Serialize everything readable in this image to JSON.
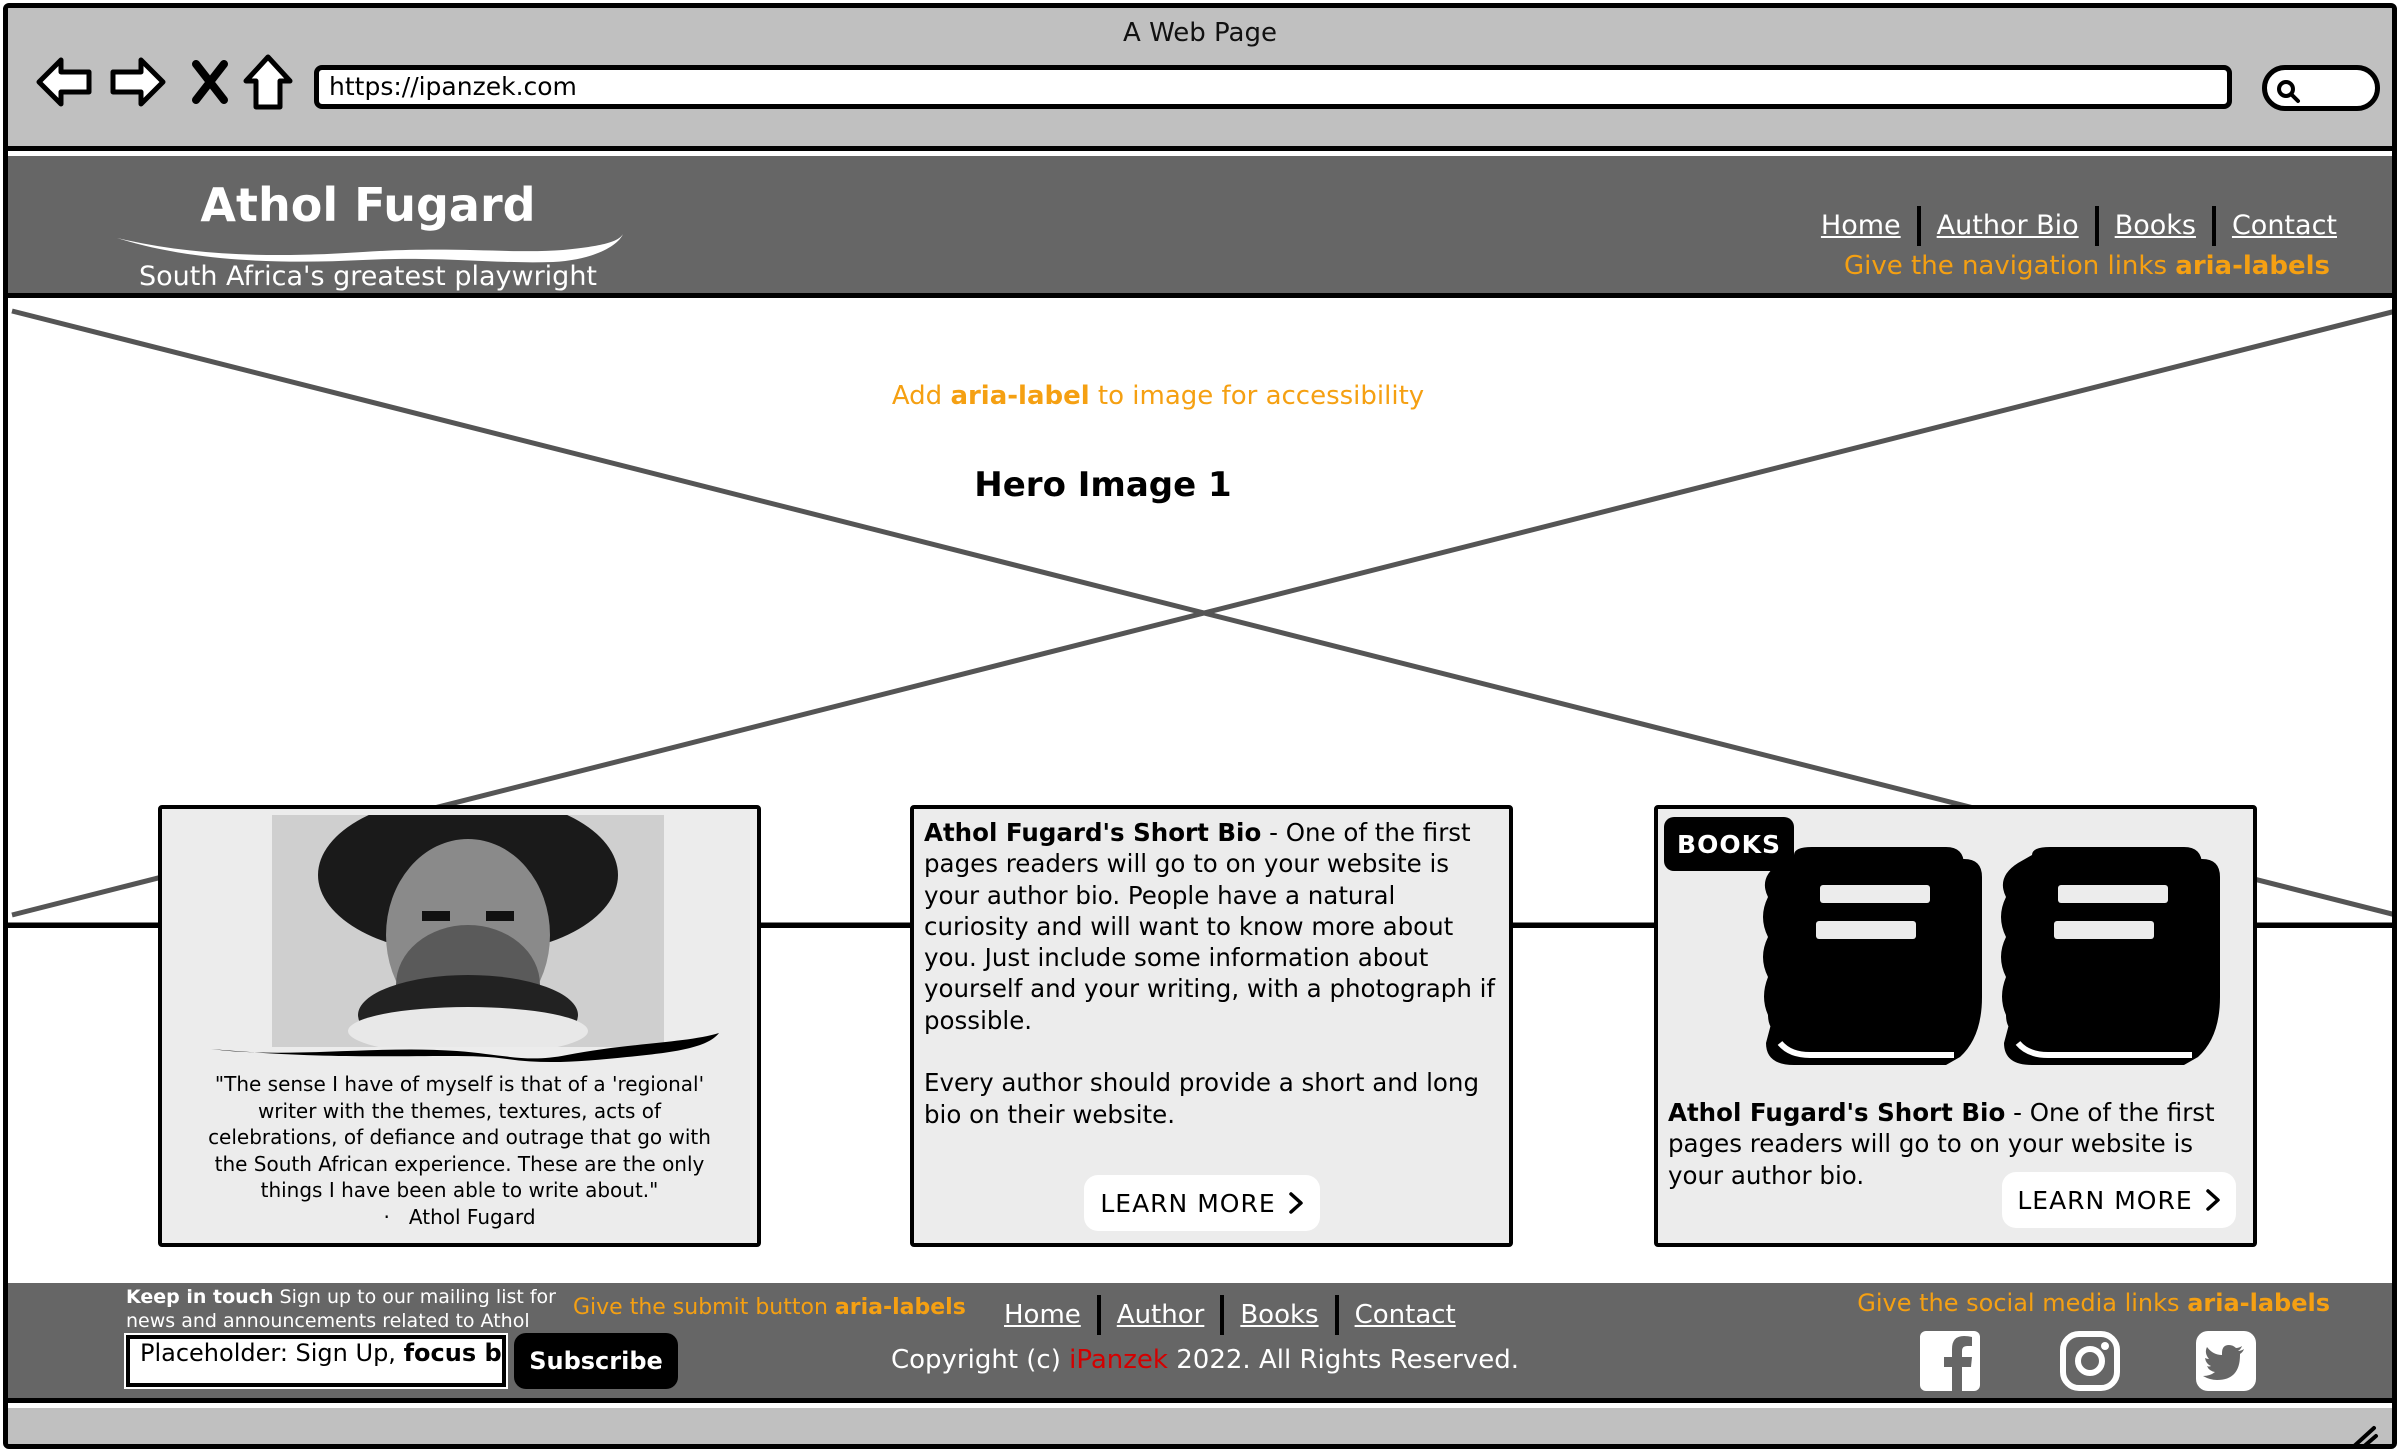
{
  "window": {
    "title": "A Web Page"
  },
  "browser": {
    "url": "https://ipanzek.com",
    "icons": [
      "back-arrow-icon",
      "forward-arrow-icon",
      "close-x-icon",
      "home-icon",
      "search-icon"
    ]
  },
  "header": {
    "site_title": "Athol Fugard",
    "tagline": "South Africa's greatest playwright",
    "nav": [
      "Home",
      "Author Bio",
      "Books",
      "Contact"
    ],
    "nav_note_prefix": "Give the navigation links ",
    "nav_note_strong": "aria-labels"
  },
  "hero": {
    "note_prefix": "Add ",
    "note_strong": "aria-label",
    "note_suffix": " to image for accessibility",
    "title": "Hero Image 1"
  },
  "cards": {
    "quote": {
      "text": "\"The sense I have of myself is that of a 'regional' writer with the themes, textures, acts of celebrations, of defiance and outrage that go with the South African experience. These are the only things I have been able to write about.\"",
      "attribution": "Athol Fugard"
    },
    "bio": {
      "title": "Athol Fugard's Short Bio",
      "paragraph1": " - One of the first pages readers will go to on your website is your author bio. People have a natural curiosity and will want to know more about you. Just include some information about yourself and your writing, with a photograph if possible.",
      "paragraph2": "Every author should provide a short and long bio on their website.",
      "button": "LEARN MORE"
    },
    "books": {
      "badge": "BOOKS",
      "title": "Athol Fugard's Short Bio",
      "text": " - One of the first pages readers will go to on your website is your author bio.",
      "button": "LEARN MORE"
    }
  },
  "footer": {
    "keep_strong": "Keep in touch",
    "keep_text": " Sign up to our mailing list for news and announcements related to Athol Fugard",
    "submit_note_prefix": "Give the submit button ",
    "submit_note_strong": "aria-labels",
    "signup_placeholder_plain": "Placeholder: Sign Up, ",
    "signup_placeholder_strong": "focus b",
    "subscribe": "Subscribe",
    "nav": [
      "Home",
      "Author",
      "Books",
      "Contact"
    ],
    "copyright_prefix": "Copyright (c) ",
    "copyright_brand": "iPanzek",
    "copyright_suffix": " 2022. All Rights Reserved.",
    "social_note_prefix": "Give the social media links ",
    "social_note_strong": "aria-labels",
    "social_icons": [
      "facebook-icon",
      "instagram-icon",
      "twitter-icon"
    ]
  },
  "colors": {
    "chrome": "#c0c0c0",
    "header_bg": "#666666",
    "note": "#f5a012",
    "brand_red": "#d40000",
    "card_bg": "#ececec"
  }
}
